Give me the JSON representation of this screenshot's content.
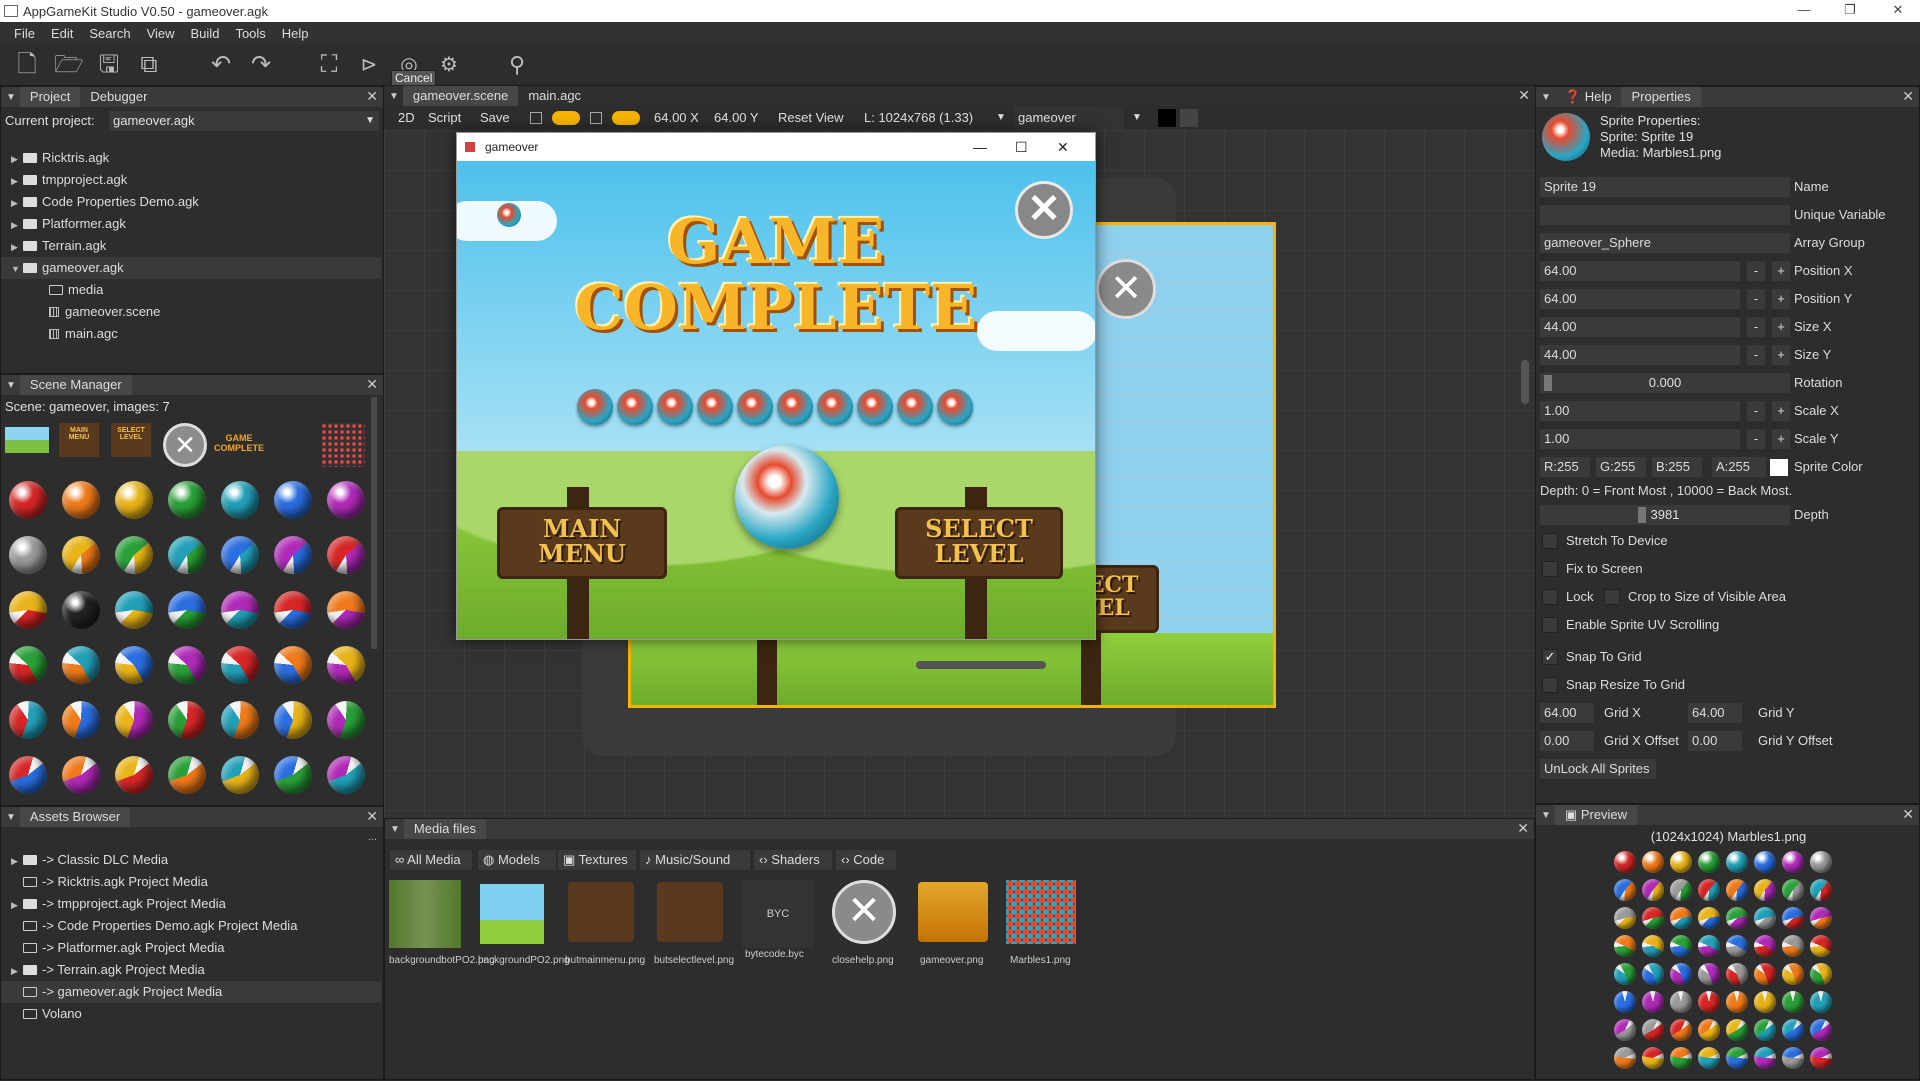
{
  "window": {
    "title": "AppGameKit Studio V0.50 - gameover.agk",
    "min": "—",
    "max": "❐",
    "close": "✕"
  },
  "menu": [
    "File",
    "Edit",
    "Search",
    "View",
    "Build",
    "Tools",
    "Help"
  ],
  "toolbar": {
    "cancel_tooltip": "Cancel"
  },
  "project_panel": {
    "tabs": [
      "Project",
      "Debugger"
    ],
    "current_label": "Current project:",
    "current_value": "gameover.agk",
    "items": [
      {
        "label": "Ricktris.agk",
        "type": "folder",
        "indent": 0
      },
      {
        "label": "tmpproject.agk",
        "type": "folder",
        "indent": 0
      },
      {
        "label": "Code Properties Demo.agk",
        "type": "folder",
        "indent": 0
      },
      {
        "label": "Platformer.agk",
        "type": "folder",
        "indent": 0
      },
      {
        "label": "Terrain.agk",
        "type": "folder",
        "indent": 0
      },
      {
        "label": "gameover.agk",
        "type": "folder-open",
        "indent": 0
      },
      {
        "label": "media",
        "type": "folder",
        "indent": 1
      },
      {
        "label": "gameover.scene",
        "type": "file",
        "indent": 1
      },
      {
        "label": "main.agc",
        "type": "file",
        "indent": 1
      }
    ]
  },
  "scene_manager": {
    "title": "Scene Manager",
    "info": "Scene: gameover, images: 7",
    "thumb_labels": {
      "main_menu": "MAIN MENU",
      "select_level": "SELECT LEVEL",
      "game_complete": "GAME COMPLETE"
    }
  },
  "assets_browser": {
    "title": "Assets Browser",
    "more": "...",
    "items": [
      {
        "label": "-> Classic DLC Media",
        "arrow": true
      },
      {
        "label": "-> Ricktris.agk Project Media",
        "arrow": false
      },
      {
        "label": "-> tmpproject.agk Project Media",
        "arrow": true
      },
      {
        "label": "-> Code Properties Demo.agk Project Media",
        "arrow": false
      },
      {
        "label": "-> Platformer.agk Project Media",
        "arrow": false
      },
      {
        "label": "-> Terrain.agk Project Media",
        "arrow": true
      },
      {
        "label": "-> gameover.agk Project Media",
        "arrow": false,
        "selected": true
      },
      {
        "label": "Volano",
        "arrow": false
      }
    ]
  },
  "editor": {
    "tabs": [
      "gameover.scene",
      "main.agc"
    ],
    "toolbar": {
      "mode": "2D",
      "script": "Script",
      "save": "Save",
      "x": "64.00 X",
      "y": "64.00 Y",
      "reset": "Reset View",
      "layout": "L: 1024x768 (1.33)",
      "scene": "gameover"
    }
  },
  "game_window": {
    "title": "gameover",
    "title_text_1": "GAME",
    "title_text_2": "COMPLETE",
    "main_menu": "MAIN MENU",
    "select_level": "SELECT LEVEL"
  },
  "scene_canvas": {
    "select_level": "SELECT LEVEL",
    "partial_letter": "E"
  },
  "help_panel": {
    "tabs": [
      "Help",
      "Properties"
    ],
    "info": [
      "Sprite Properties:",
      "Sprite: Sprite 19",
      "Media: Marbles1.png"
    ],
    "fields": {
      "name": "Sprite 19",
      "name_label": "Name",
      "unique_label": "Unique Variable",
      "array_group": "gameover_Sphere",
      "array_label": "Array Group",
      "pos_x": "64.00",
      "pos_x_label": "Position X",
      "pos_y": "64.00",
      "pos_y_label": "Position Y",
      "size_x": "44.00",
      "size_x_label": "Size X",
      "size_y": "44.00",
      "size_y_label": "Size Y",
      "rotation": "0.000",
      "rotation_label": "Rotation",
      "scale_x": "1.00",
      "scale_x_label": "Scale X",
      "scale_y": "1.00",
      "scale_y_label": "Scale Y",
      "r": "R:255",
      "g": "G:255",
      "b": "B:255",
      "a": "A:255",
      "color_label": "Sprite Color",
      "depth_note": "Depth: 0 = Front Most , 10000 = Back Most.",
      "depth": "3981",
      "depth_label": "Depth",
      "stretch": "Stretch To Device",
      "fix": "Fix to Screen",
      "lock": "Lock",
      "crop": "Crop to Size of Visible Area",
      "uv": "Enable Sprite UV Scrolling",
      "snap": "Snap To Grid",
      "snap_resize": "Snap Resize To Grid",
      "grid_x": "64.00",
      "grid_x_label": "Grid X",
      "grid_y": "64.00",
      "grid_y_label": "Grid Y",
      "grid_x_off": "0.00",
      "grid_x_off_label": "Grid X Offset",
      "grid_y_off": "0.00",
      "grid_y_off_label": "Grid Y Offset",
      "unlock": "UnLock All Sprites",
      "minus": "-",
      "plus": "+"
    }
  },
  "media_files": {
    "title": "Media files",
    "tabs": [
      "All Media",
      "Models",
      "Textures",
      "Music/Sound",
      "Shaders",
      "Code"
    ],
    "files": [
      {
        "name": "backgroundbotPO2.png"
      },
      {
        "name": "backgroundPO2.png"
      },
      {
        "name": "butmainmenu.png"
      },
      {
        "name": "butselectlevel.png"
      },
      {
        "name": "bytecode.byc",
        "thumb_text": "BYC"
      },
      {
        "name": "closehelp.png"
      },
      {
        "name": "gameover.png"
      },
      {
        "name": "Marbles1.png"
      }
    ]
  },
  "preview": {
    "title": "Preview",
    "caption": "(1024x1024) Marbles1.png"
  },
  "colors": {
    "accent": "#f5b400",
    "panel": "#2d2d2d",
    "header": "#3a3a3a",
    "sky": "#5ec8ef",
    "grass": "#8fce3c"
  }
}
